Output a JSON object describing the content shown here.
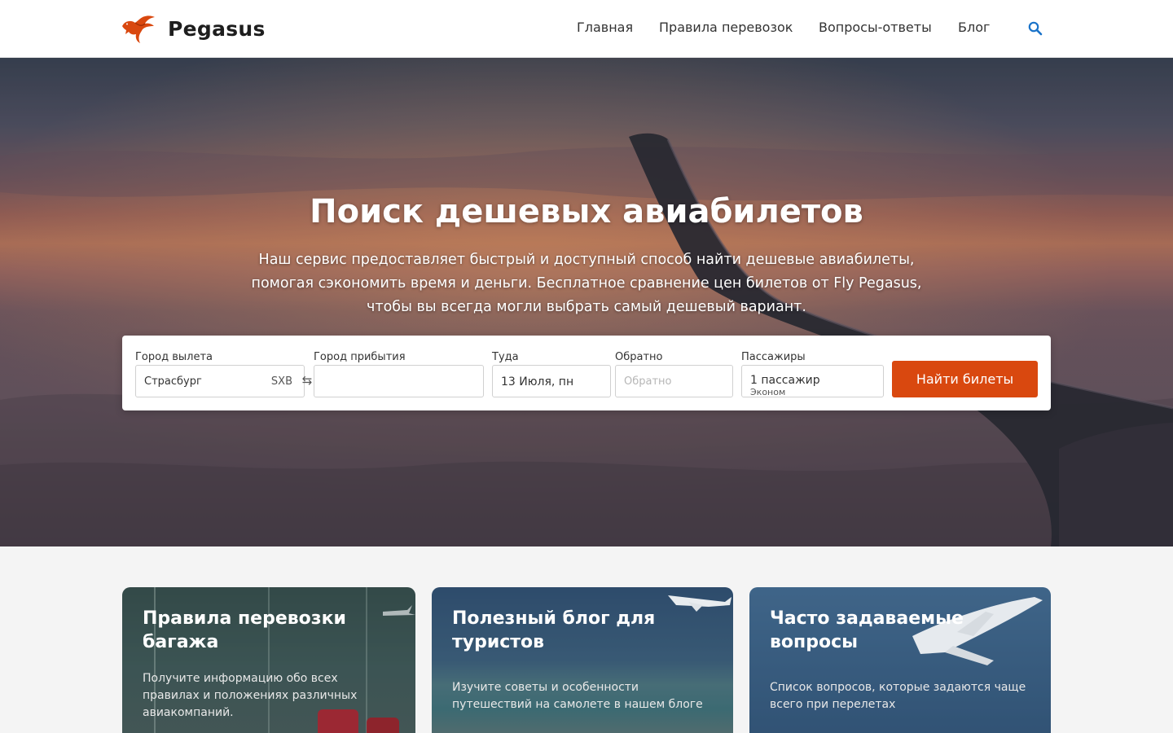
{
  "header": {
    "brand": "Pegasus",
    "nav": [
      {
        "label": "Главная"
      },
      {
        "label": "Правила перевозок"
      },
      {
        "label": "Вопросы-ответы"
      },
      {
        "label": "Блог"
      }
    ],
    "search_icon": "search-icon"
  },
  "hero": {
    "title": "Поиск дешевых авиабилетов",
    "description_lines": [
      "Наш сервис предоставляет быстрый и доступный способ найти дешевые авиабилеты,",
      "помогая сэкономить время и деньги. Бесплатное сравнение цен билетов от Fly Pegasus,",
      "чтобы вы всегда могли выбрать самый дешевый вариант."
    ]
  },
  "search_form": {
    "from": {
      "label": "Город вылета",
      "value": "Страсбург",
      "code": "SXB"
    },
    "swap_icon": "swap-icon",
    "to": {
      "label": "Город прибытия",
      "value": ""
    },
    "depart": {
      "label": "Туда",
      "value": "13 Июля, пн"
    },
    "return": {
      "label": "Обратно",
      "placeholder": "Обратно"
    },
    "passengers": {
      "label": "Пассажиры",
      "value": "1 пассажир",
      "class": "Эконом"
    },
    "submit": "Найти билеты"
  },
  "cards": [
    {
      "title_lines": [
        "Правила перевозки",
        "багажа"
      ],
      "text_lines": [
        "Получите информацию обо всех",
        "правилах и положениях различных",
        "авиакомпаний."
      ]
    },
    {
      "title_lines": [
        "Полезный блог для",
        "туристов"
      ],
      "text_lines": [
        "Изучите советы и особенности",
        "путешествий на самолете в нашем блоге"
      ]
    },
    {
      "title_lines": [
        "Часто задаваемые",
        "вопросы"
      ],
      "text_lines": [
        "Список вопросов, которые задаются чаще",
        "всего при перелетах"
      ]
    }
  ],
  "colors": {
    "accent": "#d9480f",
    "search_icon": "#1a73c9"
  }
}
